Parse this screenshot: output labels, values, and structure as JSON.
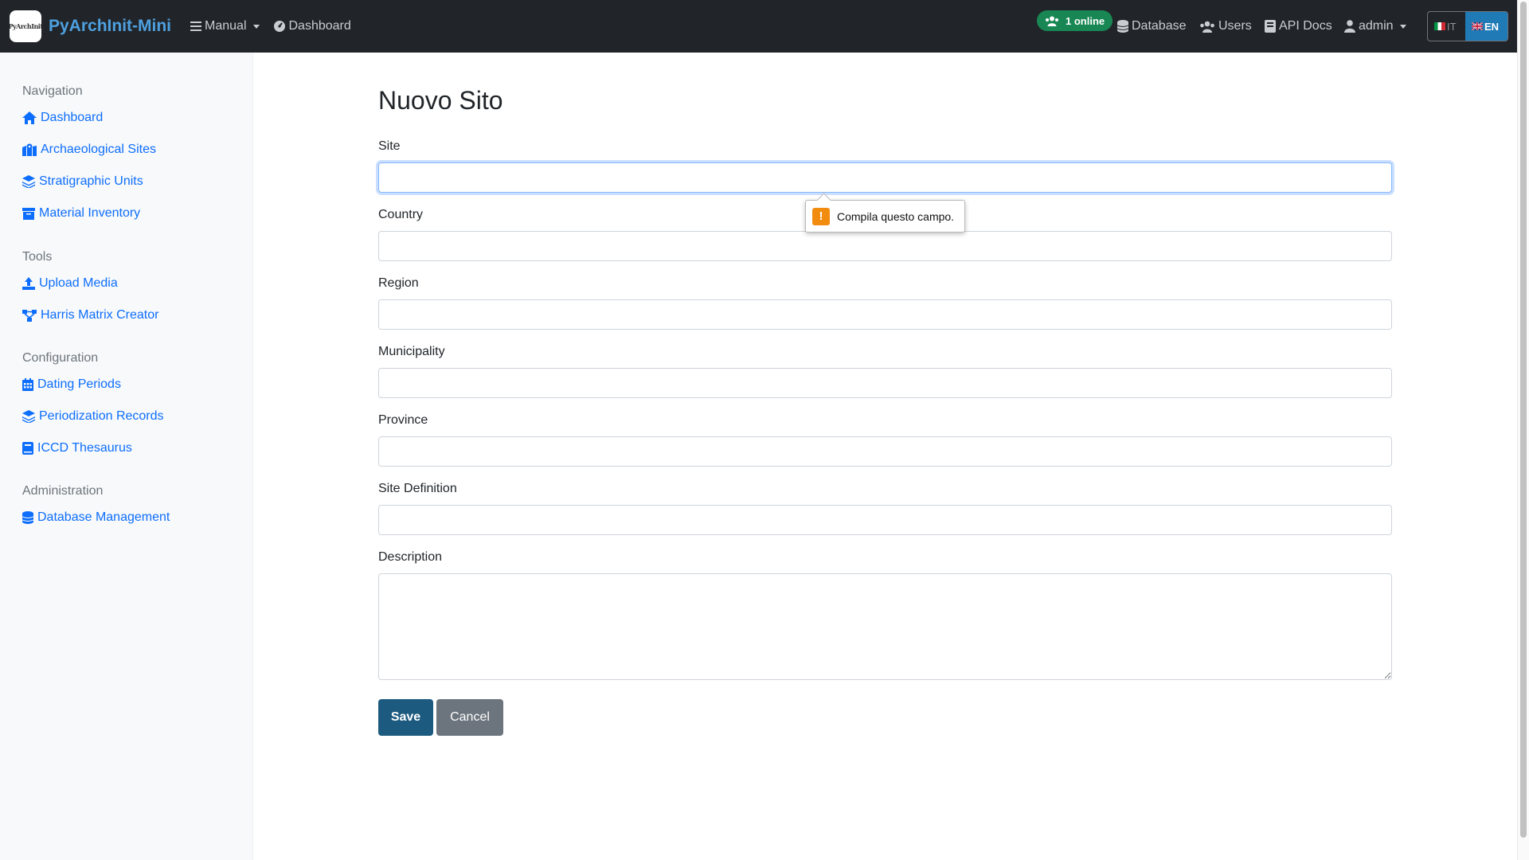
{
  "navbar": {
    "logo_text": "PyArchInit",
    "brand": "PyArchInit-Mini",
    "manual": "Manual",
    "dashboard": "Dashboard",
    "online_badge": "1 online",
    "database": "Database",
    "users": "Users",
    "api_docs": "API Docs",
    "user": "admin",
    "lang_it": "IT",
    "lang_en": "EN"
  },
  "sidebar": {
    "navigation_heading": "Navigation",
    "dashboard": "Dashboard",
    "archaeological_sites": "Archaeological Sites",
    "stratigraphic_units": "Stratigraphic Units",
    "material_inventory": "Material Inventory",
    "tools_heading": "Tools",
    "upload_media": "Upload Media",
    "harris_matrix_creator": "Harris Matrix Creator",
    "configuration_heading": "Configuration",
    "dating_periods": "Dating Periods",
    "periodization_records": "Periodization Records",
    "iccd_thesaurus": "ICCD Thesaurus",
    "administration_heading": "Administration",
    "database_management": "Database Management"
  },
  "form": {
    "title": "Nuovo Sito",
    "site_label": "Site",
    "site_value": "",
    "country_label": "Country",
    "country_value": "",
    "region_label": "Region",
    "region_value": "",
    "municipality_label": "Municipality",
    "municipality_value": "",
    "province_label": "Province",
    "province_value": "",
    "site_definition_label": "Site Definition",
    "site_definition_value": "",
    "description_label": "Description",
    "description_value": "",
    "save_label": "Save",
    "cancel_label": "Cancel"
  },
  "validation": {
    "message": "Compila questo campo."
  },
  "colors": {
    "navbar_bg": "#212529",
    "brand": "#4ea0e0",
    "link": "#0d6efd",
    "online_badge": "#198754",
    "save_button": "#1c5b7f",
    "cancel_button": "#6c757d",
    "lang_active": "#1f7ab5",
    "warning": "#f28c0f"
  }
}
